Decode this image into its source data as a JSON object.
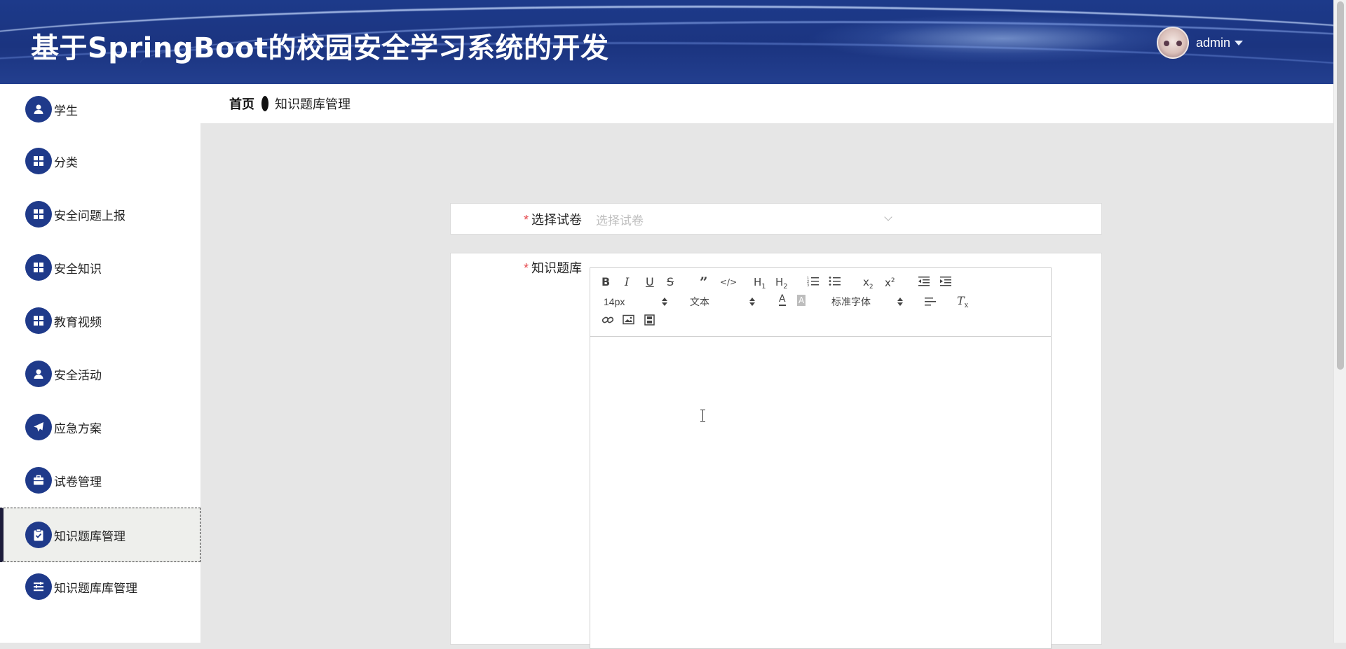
{
  "header": {
    "title": "基于SpringBoot的校园安全学习系统的开发",
    "user": {
      "name": "admin",
      "avatar_icon": "avatar-icon",
      "menu_icon": "caret-down-icon"
    }
  },
  "sidebar": {
    "items": [
      {
        "label": "学生",
        "icon": "user-icon"
      },
      {
        "label": "分类",
        "icon": "grid-icon"
      },
      {
        "label": "安全问题上报",
        "icon": "grid-icon"
      },
      {
        "label": "安全知识",
        "icon": "grid-icon"
      },
      {
        "label": "教育视频",
        "icon": "grid-icon"
      },
      {
        "label": "安全活动",
        "icon": "user-icon"
      },
      {
        "label": "应急方案",
        "icon": "paper-plane-icon"
      },
      {
        "label": "试卷管理",
        "icon": "briefcase-icon"
      },
      {
        "label": "知识题库管理",
        "icon": "clipboard-check-icon",
        "active": true
      },
      {
        "label": "知识题库库管理",
        "icon": "list-icon"
      }
    ]
  },
  "breadcrumb": {
    "home": "首页",
    "current": "知识题库管理"
  },
  "form": {
    "paper": {
      "label": "选择试卷",
      "placeholder": "选择试卷",
      "required": "*"
    },
    "question": {
      "label": "知识题库",
      "required": "*"
    }
  },
  "editor": {
    "font_size": "14px",
    "block_format": "文本",
    "font_family": "标准字体",
    "tools": [
      "bold",
      "italic",
      "underline",
      "strike",
      "blockquote",
      "code-block",
      "header-1",
      "header-2",
      "ordered-list",
      "bullet-list",
      "subscript",
      "superscript",
      "outdent",
      "indent",
      "font-color",
      "background-color",
      "align",
      "clear-format",
      "link",
      "image",
      "video"
    ]
  },
  "colors": {
    "header_bg": "#1d3a8a",
    "icon_bg": "#1f3a8a",
    "required": "#e5484d",
    "content_bg": "#e6e6e6"
  }
}
